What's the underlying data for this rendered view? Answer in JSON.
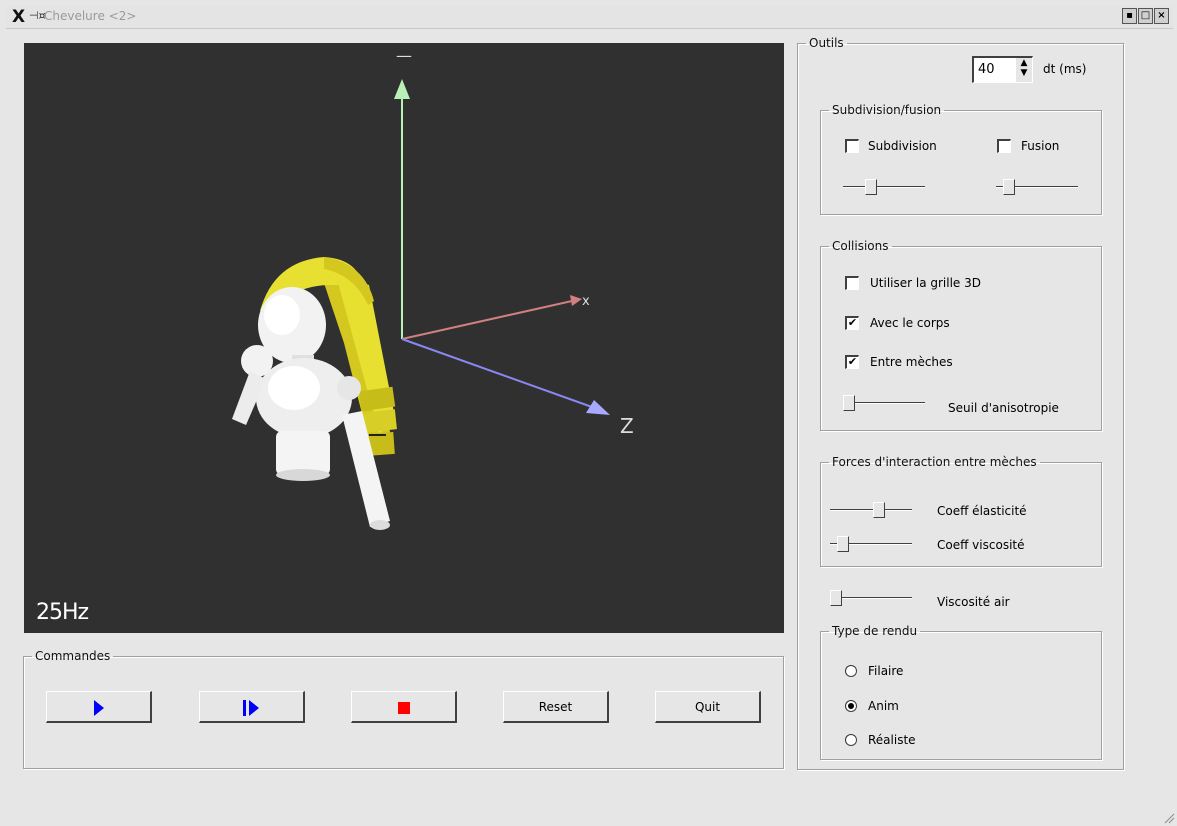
{
  "window": {
    "title": "Chevelure <2>",
    "logo_glyph": "X",
    "pin_glyph": "⊣¤",
    "buttons": {
      "minimize": "▪",
      "maximize": "□",
      "close": "×"
    }
  },
  "viewport": {
    "fps": "25Hz",
    "background": "#303030",
    "axes": {
      "x_label": "x",
      "z_label": "Z",
      "y_marker": "—"
    },
    "icons": [
      "character-model-icon"
    ]
  },
  "commands": {
    "legend": "Commandes",
    "play_icon": "play-icon",
    "step_icon": "step-icon",
    "stop_icon": "stop-icon",
    "reset_label": "Reset",
    "quit_label": "Quit"
  },
  "tools": {
    "legend": "Outils",
    "dt": {
      "value": "40",
      "label": "dt (ms)"
    },
    "subdivision": {
      "legend": "Subdivision/fusion",
      "subdivision_label": "Subdivision",
      "subdivision_checked": false,
      "fusion_label": "Fusion",
      "fusion_checked": false,
      "subdivision_slider": 0.3,
      "fusion_slider": 0.1
    },
    "collisions": {
      "legend": "Collisions",
      "grid_label": "Utiliser la grille 3D",
      "grid_checked": false,
      "body_label": "Avec le corps",
      "body_checked": true,
      "strands_label": "Entre mèches",
      "strands_checked": true,
      "anisotropy_label": "Seuil d'anisotropie",
      "anisotropy_slider": 0.0,
      "check_glyph": "✔"
    },
    "forces": {
      "legend": "Forces d'interaction entre mèches",
      "elasticity_label": "Coeff élasticité",
      "elasticity_slider": 0.6,
      "viscosity_label": "Coeff viscosité",
      "viscosity_slider": 0.1
    },
    "air": {
      "label": "Viscosité air",
      "slider": 0.0
    },
    "render": {
      "legend": "Type de rendu",
      "wireframe_label": "Filaire",
      "anim_label": "Anim",
      "realistic_label": "Réaliste",
      "selected": "anim"
    }
  },
  "colors": {
    "accent_play": "#0000ff",
    "accent_stop": "#ff0000",
    "axis_y": "#b8f0b8",
    "axis_x": "#d08080",
    "axis_z": "#8888ee",
    "hair": "#e8e030"
  }
}
